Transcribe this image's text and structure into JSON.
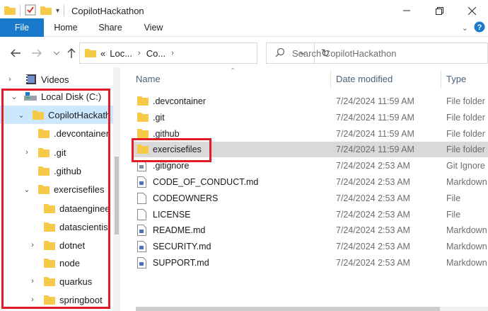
{
  "window": {
    "title": "CopilotHackathon"
  },
  "ribbon": {
    "tabs": [
      "File",
      "Home",
      "Share",
      "View"
    ]
  },
  "address": {
    "crumbs": [
      "Loc...",
      "Co..."
    ],
    "prefix": "«"
  },
  "search": {
    "placeholder": "Search CopilotHackathon"
  },
  "nav": {
    "items": [
      {
        "label": "Videos",
        "icon": "videos-icon",
        "arrow": "›"
      },
      {
        "label": "Local Disk (C:)",
        "icon": "drive-icon",
        "arrow": "⌄"
      },
      {
        "label": "CopilotHackath",
        "icon": "folder-icon",
        "arrow": "⌄"
      },
      {
        "label": ".devcontainer",
        "icon": "folder-icon",
        "arrow": ""
      },
      {
        "label": ".git",
        "icon": "folder-icon",
        "arrow": "›"
      },
      {
        "label": ".github",
        "icon": "folder-icon",
        "arrow": ""
      },
      {
        "label": "exercisefiles",
        "icon": "folder-icon",
        "arrow": "⌄"
      },
      {
        "label": "dataenginee",
        "icon": "folder-icon",
        "arrow": ""
      },
      {
        "label": "datascientis",
        "icon": "folder-icon",
        "arrow": ""
      },
      {
        "label": "dotnet",
        "icon": "folder-icon",
        "arrow": "›"
      },
      {
        "label": "node",
        "icon": "folder-icon",
        "arrow": ""
      },
      {
        "label": "quarkus",
        "icon": "folder-icon",
        "arrow": "›"
      },
      {
        "label": "springboot",
        "icon": "folder-icon",
        "arrow": "›"
      }
    ]
  },
  "columns": {
    "name": "Name",
    "date": "Date modified",
    "type": "Type"
  },
  "files": [
    {
      "name": ".devcontainer",
      "date": "7/24/2024 11:59 AM",
      "type": "File folder",
      "icon": "folder"
    },
    {
      "name": ".git",
      "date": "7/24/2024 11:59 AM",
      "type": "File folder",
      "icon": "folder"
    },
    {
      "name": ".github",
      "date": "7/24/2024 11:59 AM",
      "type": "File folder",
      "icon": "folder"
    },
    {
      "name": "exercisefiles",
      "date": "7/24/2024 11:59 AM",
      "type": "File folder",
      "icon": "folder"
    },
    {
      "name": ".gitignore",
      "date": "7/24/2024 2:53 AM",
      "type": "Git Ignore",
      "icon": "gitignore"
    },
    {
      "name": "CODE_OF_CONDUCT.md",
      "date": "7/24/2024 2:53 AM",
      "type": "Markdown",
      "icon": "md"
    },
    {
      "name": "CODEOWNERS",
      "date": "7/24/2024 2:53 AM",
      "type": "File",
      "icon": "file"
    },
    {
      "name": "LICENSE",
      "date": "7/24/2024 2:53 AM",
      "type": "File",
      "icon": "file"
    },
    {
      "name": "README.md",
      "date": "7/24/2024 2:53 AM",
      "type": "Markdown",
      "icon": "md"
    },
    {
      "name": "SECURITY.md",
      "date": "7/24/2024 2:53 AM",
      "type": "Markdown",
      "icon": "md"
    },
    {
      "name": "SUPPORT.md",
      "date": "7/24/2024 2:53 AM",
      "type": "Markdown",
      "icon": "md"
    }
  ],
  "colors": {
    "accent": "#1979ca",
    "highlight": "#e21d2a",
    "selected": "#cce8ff",
    "folder": "#f7c948"
  }
}
